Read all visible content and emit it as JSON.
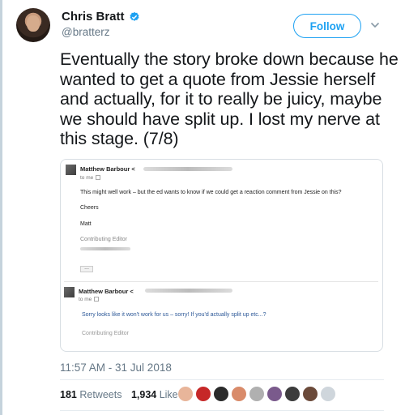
{
  "colors": {
    "brand_blue": "#1da1f2",
    "text_primary": "#14171a",
    "text_secondary": "#657786",
    "thread_line": "#c5d3dc"
  },
  "author": {
    "display_name": "Chris Bratt",
    "handle": "@bratterz",
    "verified_icon": "verified-badge-icon",
    "follow_label": "Follow",
    "menu_icon": "chevron-down-icon"
  },
  "tweet": {
    "text": "Eventually the story broke down because he wanted to get a quote from Jessie herself and actually, for it to really be juicy, maybe we should have split up. I lost my nerve at this stage. (7/8)",
    "timestamp": "11:57 AM - 31 Jul 2018"
  },
  "media": {
    "email_1": {
      "sender": "Matthew Barbour <",
      "to_me": "to me",
      "body": "This might well work – but the ed wants to know if we could get a reaction comment from Jessie on this?",
      "greeting": "Cheers",
      "name": "Matt",
      "signature": "Contributing Editor",
      "ellipsis": "..."
    },
    "email_2": {
      "sender": "Matthew Barbour <",
      "to_me": "to me",
      "body": "Sorry looks like it won't work for us – sorry! If you'd actually split up etc...?",
      "signature": "Contributing Editor"
    }
  },
  "stats": {
    "retweets_count": "181",
    "retweets_label": "Retweets",
    "likes_count": "1,934",
    "likes_label": "Likes"
  },
  "likers": [
    {
      "icon": "liker-avatar-1",
      "color": "#e8b59a"
    },
    {
      "icon": "liker-avatar-2",
      "color": "#c62828"
    },
    {
      "icon": "liker-avatar-3",
      "color": "#2b2b2b"
    },
    {
      "icon": "liker-avatar-4",
      "color": "#d98b6a"
    },
    {
      "icon": "liker-avatar-5",
      "color": "#b0b0b0"
    },
    {
      "icon": "liker-avatar-6",
      "color": "#7a5a8c"
    },
    {
      "icon": "liker-avatar-7",
      "color": "#3c3c3c"
    },
    {
      "icon": "liker-avatar-8",
      "color": "#6b4a3a"
    },
    {
      "icon": "liker-avatar-9",
      "color": "#cfd6dc"
    }
  ]
}
